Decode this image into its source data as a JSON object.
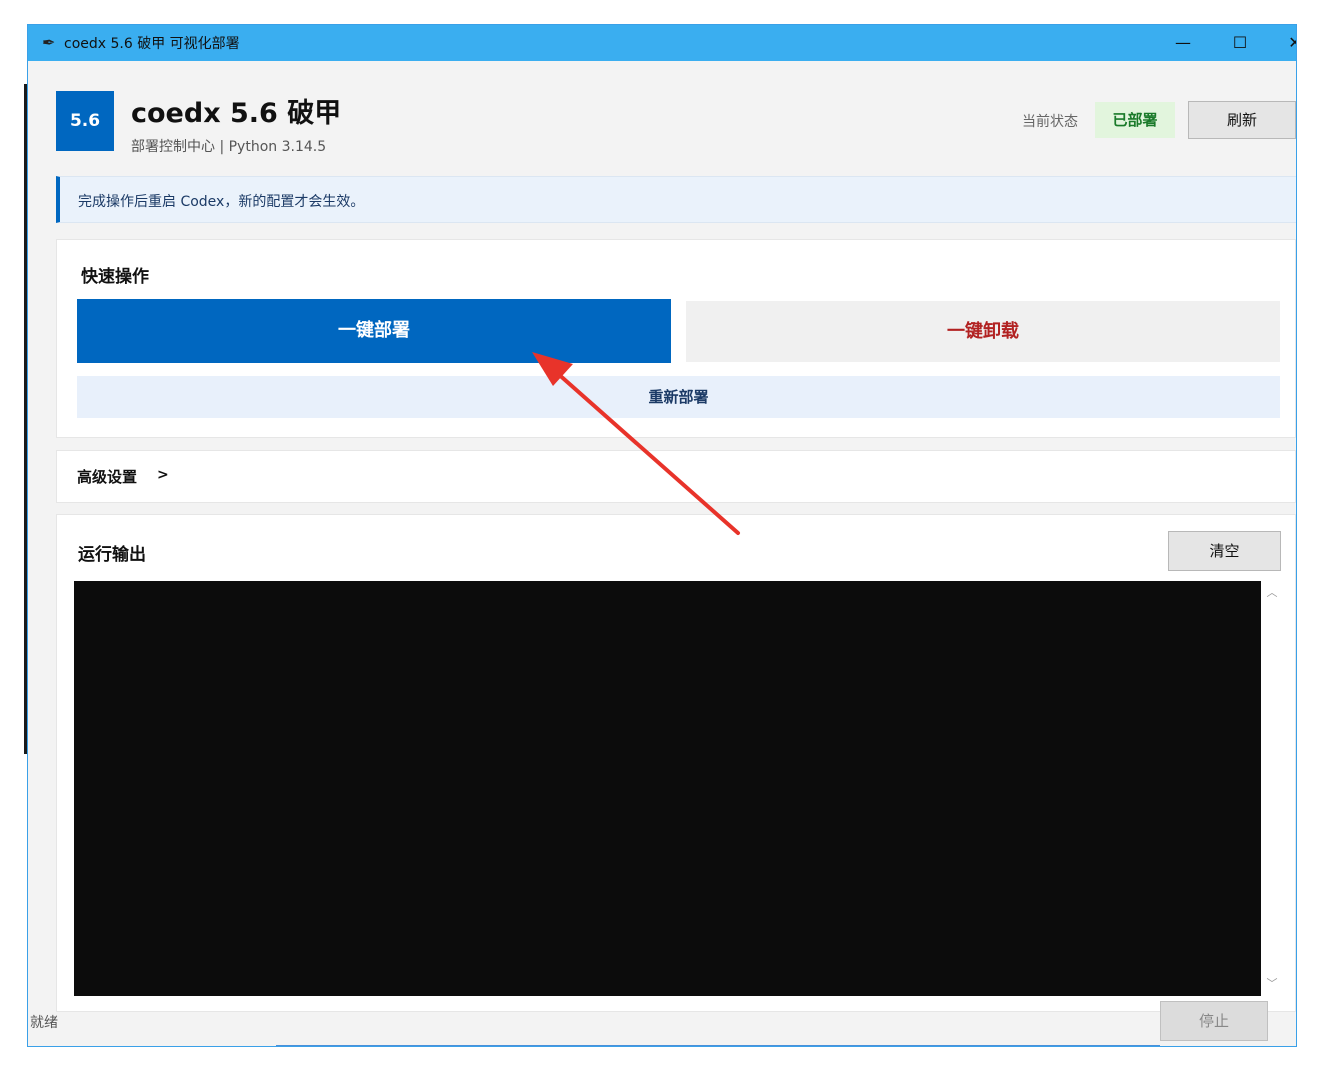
{
  "window": {
    "title": "coedx 5.6 破甲 可视化部署",
    "icon": "feather-icon",
    "minimize_glyph": "—",
    "maximize_glyph": "☐",
    "close_glyph": "✕"
  },
  "header": {
    "logo_text": "5.6",
    "title": "coedx 5.6 破甲",
    "subtitle": "部署控制中心  |  Python 3.14.5",
    "status_label": "当前状态",
    "status_value": "已部署",
    "refresh_label": "刷新"
  },
  "notice": {
    "text": "完成操作后重启 Codex，新的配置才会生效。"
  },
  "quick_actions": {
    "title": "快速操作",
    "deploy_label": "一键部署",
    "uninstall_label": "一键卸载",
    "redeploy_label": "重新部署"
  },
  "advanced": {
    "label": "高级设置",
    "chevron": ">"
  },
  "output": {
    "title": "运行输出",
    "clear_label": "清空",
    "scroll_up": "︿",
    "scroll_down": "﹀"
  },
  "footer": {
    "status_text": "就绪",
    "stop_label": "停止"
  },
  "colors": {
    "titlebar": "#3aaef0",
    "accent": "#0067c0",
    "danger": "#b22222",
    "success_bg": "#e2f5dd",
    "console_bg": "#0c0c0c",
    "annotation_arrow": "#e8332a"
  }
}
